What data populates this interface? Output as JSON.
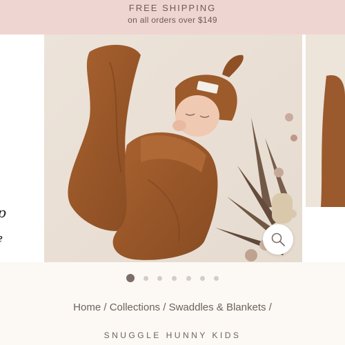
{
  "announcement": {
    "title": "FREE SHIPPING",
    "subtitle": "on all orders over $149"
  },
  "gallery": {
    "left_peek_text_1": "p",
    "left_peek_text_2": "e",
    "zoom_icon": "magnifier-icon",
    "dots_count": 7,
    "active_dot": 0
  },
  "breadcrumb": {
    "items": [
      "Home",
      "Collections",
      "Swaddles & Blankets"
    ],
    "separator": "/"
  },
  "vendor": "SNUGGLE HUNNY KIDS",
  "colors": {
    "announcement_bg": "#efd5d1",
    "text_muted": "#6e625c",
    "swaddle_rust": "#9c5a2c",
    "page_bg": "#fcf8f3"
  }
}
